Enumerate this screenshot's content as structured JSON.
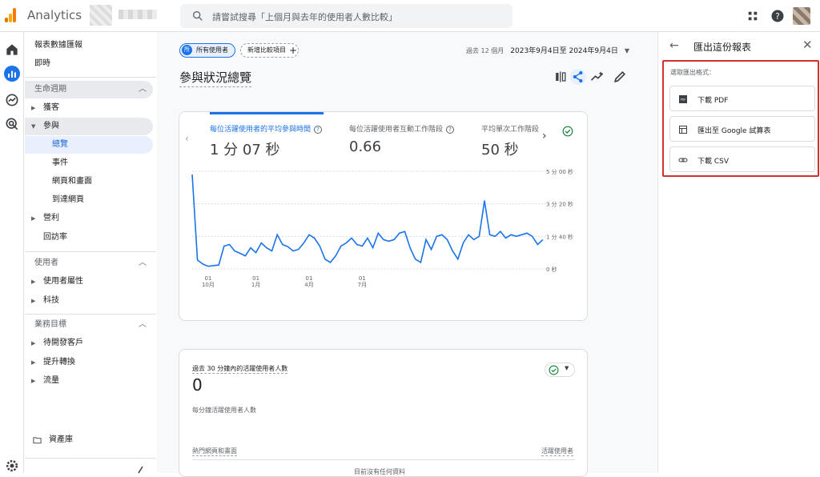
{
  "topbar": {
    "brand": "Analytics",
    "search_placeholder": "請嘗試搜尋「上個月與去年的使用者人數比較」"
  },
  "nav": {
    "reports_snapshot": "報表數據匯報",
    "realtime": "即時",
    "lifecycle_header": "生命週期",
    "acquisition": "獲客",
    "engagement": "參與",
    "overview": "總覽",
    "events": "事件",
    "pages_screens": "網頁和畫面",
    "landing_page": "到達網頁",
    "monetization": "營利",
    "retention": "回訪率",
    "user_header": "使用者",
    "user_attributes": "使用者屬性",
    "tech": "科技",
    "business_header": "業務目標",
    "generate_leads": "待開發客戶",
    "drive_conversions": "提升轉換",
    "traffic": "流量",
    "library": "資產庫"
  },
  "main": {
    "chip_badge": "所",
    "chip_all_users": "所有使用者",
    "chip_add_comparison": "新增比較項目",
    "date_prefix": "過去 12 個月",
    "date_range": "2023年9月4日至 2024年9月4日",
    "page_title": "參與狀況總覽",
    "metrics": [
      {
        "label": "每位活躍使用者的平均參與時間",
        "value": "1 分 07 秒"
      },
      {
        "label": "每位活躍使用者互動工作階段",
        "value": "0.66"
      },
      {
        "label": "平均單次工作階段",
        "value": "50 秒"
      }
    ],
    "realtime_card": {
      "title": "過去 30 分鐘內的活躍使用者人數",
      "value": "0",
      "subtitle": "每分鐘活躍使用者人數",
      "col_left": "熱門網頁和畫面",
      "col_right": "活躍使用者",
      "empty": "目前沒有任何資料"
    }
  },
  "chart_data": {
    "type": "line",
    "y_tick_labels": [
      "5 分 00 秒",
      "3 分 20 秒",
      "1 分 40 秒",
      "0 秒"
    ],
    "y_tick_seconds": [
      300,
      200,
      100,
      0
    ],
    "ylim": [
      0,
      300
    ],
    "x_tick_labels": [
      [
        "01",
        "10月"
      ],
      [
        "01",
        "1月"
      ],
      [
        "01",
        "4月"
      ],
      [
        "01",
        "7月"
      ]
    ],
    "x_tick_index": [
      3,
      12,
      22,
      32
    ],
    "grid": true,
    "series": [
      {
        "color": "#1a73e8",
        "values": [
          290,
          27,
          15,
          8,
          10,
          12,
          70,
          75,
          55,
          48,
          40,
          65,
          50,
          80,
          65,
          55,
          105,
          75,
          68,
          55,
          60,
          80,
          105,
          95,
          70,
          30,
          20,
          40,
          70,
          80,
          95,
          75,
          70,
          95,
          65,
          110,
          90,
          85,
          90,
          110,
          115,
          65,
          30,
          20,
          90,
          60,
          100,
          105,
          90,
          55,
          30,
          80,
          105,
          90,
          100,
          210,
          105,
          100,
          115,
          95,
          105,
          100,
          105,
          110,
          100,
          75,
          90
        ]
      }
    ]
  },
  "export_panel": {
    "title": "匯出這份報表",
    "subtitle": "選取匯出格式：",
    "options": [
      "下載 PDF",
      "匯出至 Google 試算表",
      "下載 CSV"
    ]
  },
  "colors": {
    "accent": "#1a73e8",
    "highlight_border": "#d32f2f"
  }
}
